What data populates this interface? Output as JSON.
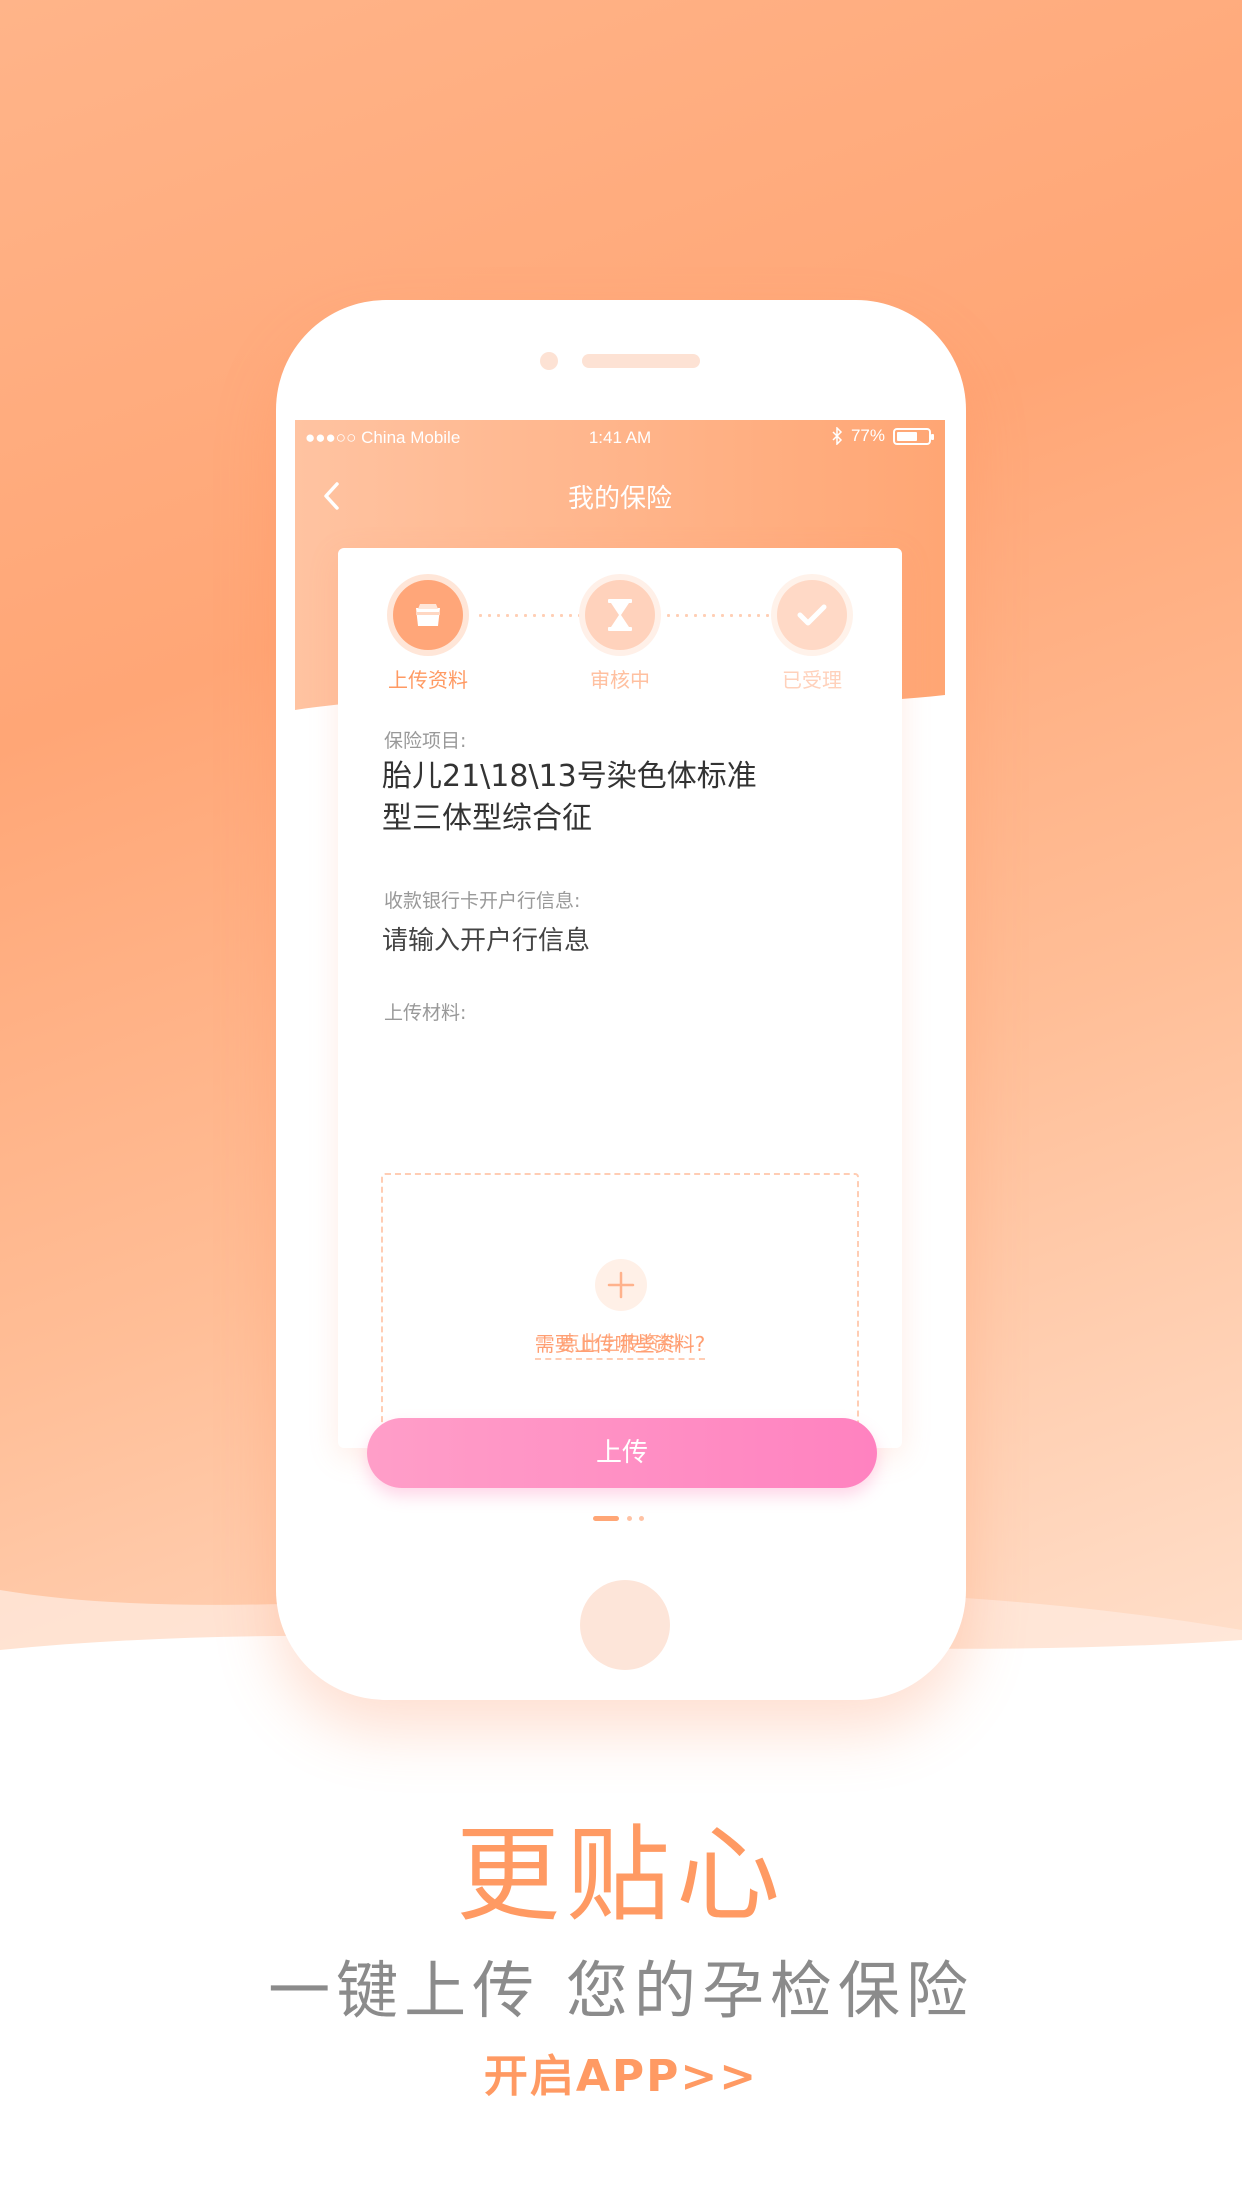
{
  "status_bar": {
    "carrier": "●●●○○ China Mobile",
    "time": "1:41 AM",
    "battery": "77%"
  },
  "header": {
    "title": "我的保险"
  },
  "steps": [
    {
      "label": "上传资料",
      "icon": "upload-icon",
      "state": "active"
    },
    {
      "label": "审核中",
      "icon": "hourglass-icon",
      "state": "pending"
    },
    {
      "label": "已受理",
      "icon": "check-icon",
      "state": "pending"
    }
  ],
  "form": {
    "insurance_label": "保险项目:",
    "insurance_value_line1": "胎儿21\\18\\13号染色体标准",
    "insurance_value_line2": "型三体型综合征",
    "bank_label": "收款银行卡开户行信息:",
    "bank_placeholder": "请输入开户行信息",
    "materials_label": "上传材料:",
    "upload_hint": "点此上传资料",
    "help_link": "需要上传哪些资料?",
    "submit_label": "上传"
  },
  "marketing": {
    "headline": "更贴心",
    "subline": "一键上传 您的孕检保险",
    "cta": "开启APP>>"
  },
  "colors": {
    "accent": "#ff9a63",
    "button_pink": "#ff8fc4",
    "muted_step": "#ffc8ae"
  }
}
